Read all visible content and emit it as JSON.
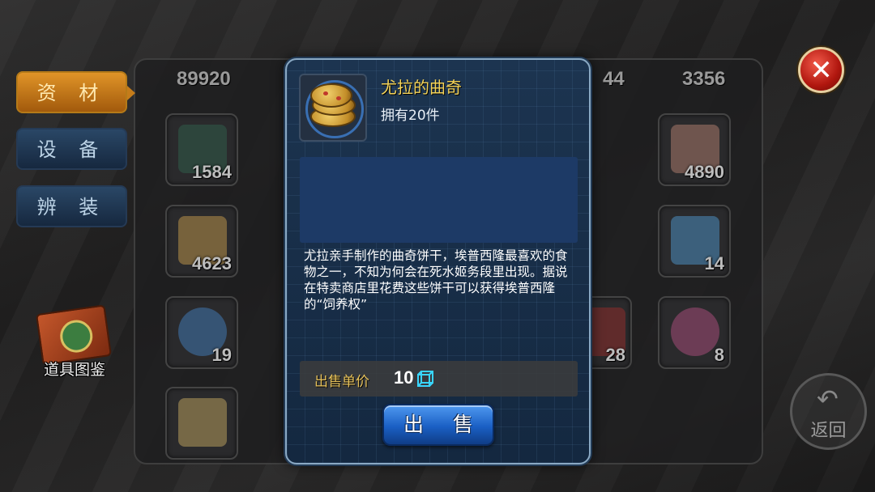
{
  "tabs": [
    {
      "label": "资 材",
      "active": true
    },
    {
      "label": "设 备",
      "active": false
    },
    {
      "label": "辨 装",
      "active": false
    }
  ],
  "guide": {
    "label": "道具图鉴"
  },
  "back": {
    "label": "返回"
  },
  "top_row_counts": [
    "89920",
    "44",
    "3356"
  ],
  "grid_counts": [
    "1584",
    "4890",
    "4623",
    "14",
    "19",
    "28",
    "8"
  ],
  "modal": {
    "item_name": "尤拉的曲奇",
    "owned_text": "拥有20件",
    "description": "尤拉亲手制作的曲奇饼干，埃普西隆最喜欢的食物之一，不知为何会在死水姬务段里出现。据说在特卖商店里花费这些饼干可以获得埃普西隆的“饲养权”",
    "price_label": "出售单价",
    "price_value": "10",
    "sell_label": "出 售"
  },
  "colors": {
    "item_name": "#f3d35a",
    "sell_button": "#1a5fc4",
    "active_tab": "#e09428",
    "close_button": "#b0160e"
  },
  "icons": {
    "close": "close-icon",
    "back": "back-arrow-icon",
    "currency": "cube-currency-icon"
  }
}
